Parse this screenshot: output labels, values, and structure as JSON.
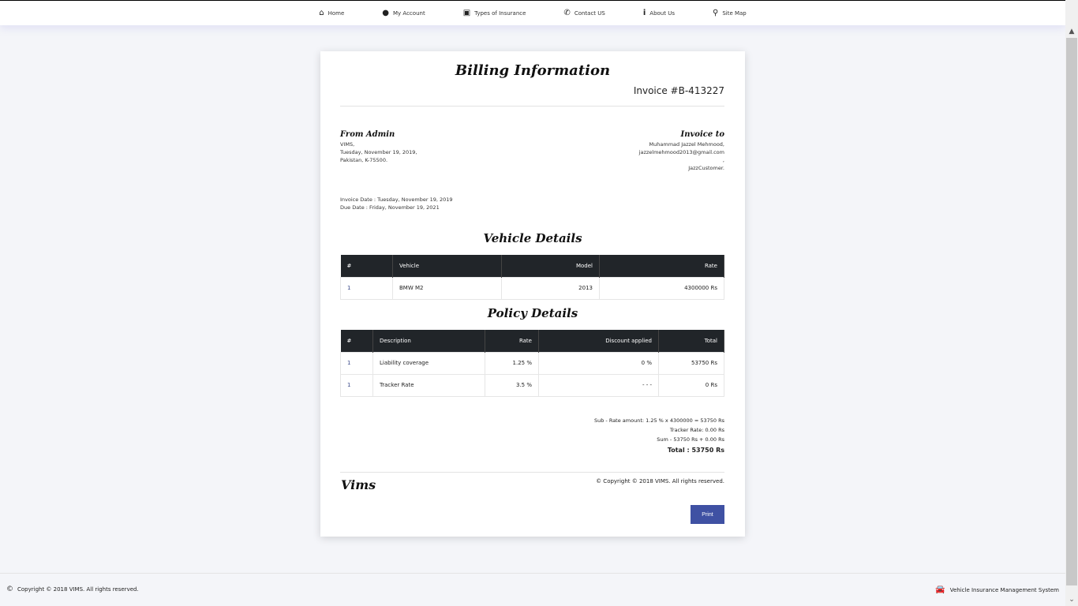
{
  "nav": [
    {
      "label": "Home",
      "icon": "home-icon",
      "glyph": "⌂"
    },
    {
      "label": "My Account",
      "icon": "user-icon",
      "glyph": "●"
    },
    {
      "label": "Types of Insurance",
      "icon": "money-icon",
      "glyph": "▣"
    },
    {
      "label": "Contact US",
      "icon": "phone-icon",
      "glyph": "✆"
    },
    {
      "label": "About Us",
      "icon": "info-icon",
      "glyph": "i"
    },
    {
      "label": "Site Map",
      "icon": "map-marker-icon",
      "glyph": "⚲"
    }
  ],
  "invoice": {
    "title": "Billing Information",
    "number": "Invoice  #B-413227",
    "from_heading": "From Admin",
    "from_lines": [
      "VIMS,",
      "Tuesday, November 19, 2019,",
      "Pakistan, K-75500."
    ],
    "to_heading": "Invoice to",
    "to_lines": [
      "Muhammad Jazzel Mehmood,",
      "jazzelmehmood2013@gmail.com",
      ",",
      "JazzCustomer."
    ],
    "invoice_date": "Invoice Date : Tuesday, November 19, 2019",
    "due_date": "Due Date : Friday, November 19, 2021",
    "vehicle_heading": "Vehicle Details",
    "vehicle_headers": [
      "#",
      "Vehicle",
      "Model",
      "Rate"
    ],
    "vehicle_rows": [
      [
        "1",
        "BMW M2",
        "2013",
        "4300000 Rs"
      ]
    ],
    "policy_heading": "Policy Details",
    "policy_headers": [
      "#",
      "Description",
      "Rate",
      "Discount applied",
      "Total"
    ],
    "policy_rows": [
      [
        "1",
        "Liability coverage",
        "1.25 %",
        "0 %",
        "53750 Rs"
      ],
      [
        "1",
        "Tracker Rate",
        "3.5 %",
        "- - -",
        "0 Rs"
      ]
    ],
    "sub_rate": "Sub - Rate amount: 1.25 % x 4300000 = 53750 Rs",
    "tracker_rate": "Tracker Rate: 0.00 Rs",
    "sum": "Sum - 53750 Rs + 0.00 Rs",
    "total": "Total : 53750 Rs",
    "brand": "Vims",
    "copyright": "© Copyright © 2018 VIMS. All rights reserved.",
    "print": "Print"
  },
  "footer": {
    "copyright": "Copyright © 2018 VIMS. All rights reserved.",
    "system": "Vehicle Insurance Management System"
  }
}
